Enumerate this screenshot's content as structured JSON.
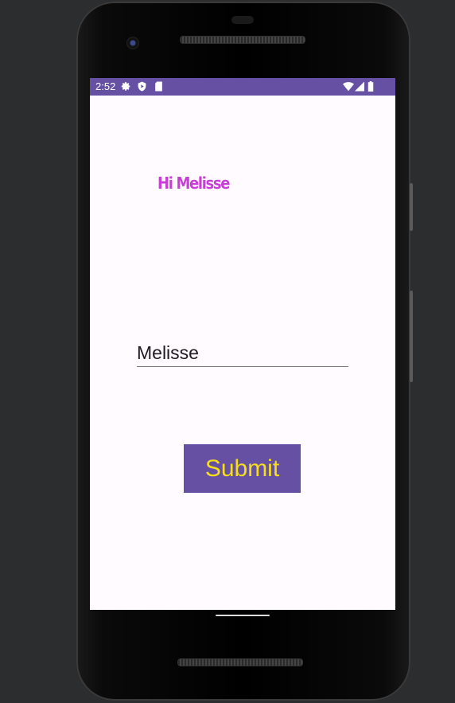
{
  "status_bar": {
    "time": "2:52",
    "icons": [
      "settings-icon",
      "shield-play-icon",
      "sd-card-icon",
      "wifi-icon",
      "signal-icon",
      "battery-icon"
    ]
  },
  "app": {
    "greeting": "Hi Melisse",
    "name_input_value": "Melisse",
    "submit_label": "Submit"
  },
  "colors": {
    "primary": "#6650a4",
    "greeting": "#c83ed6",
    "button_text": "#f6de1a",
    "background": "#fffbfe"
  }
}
